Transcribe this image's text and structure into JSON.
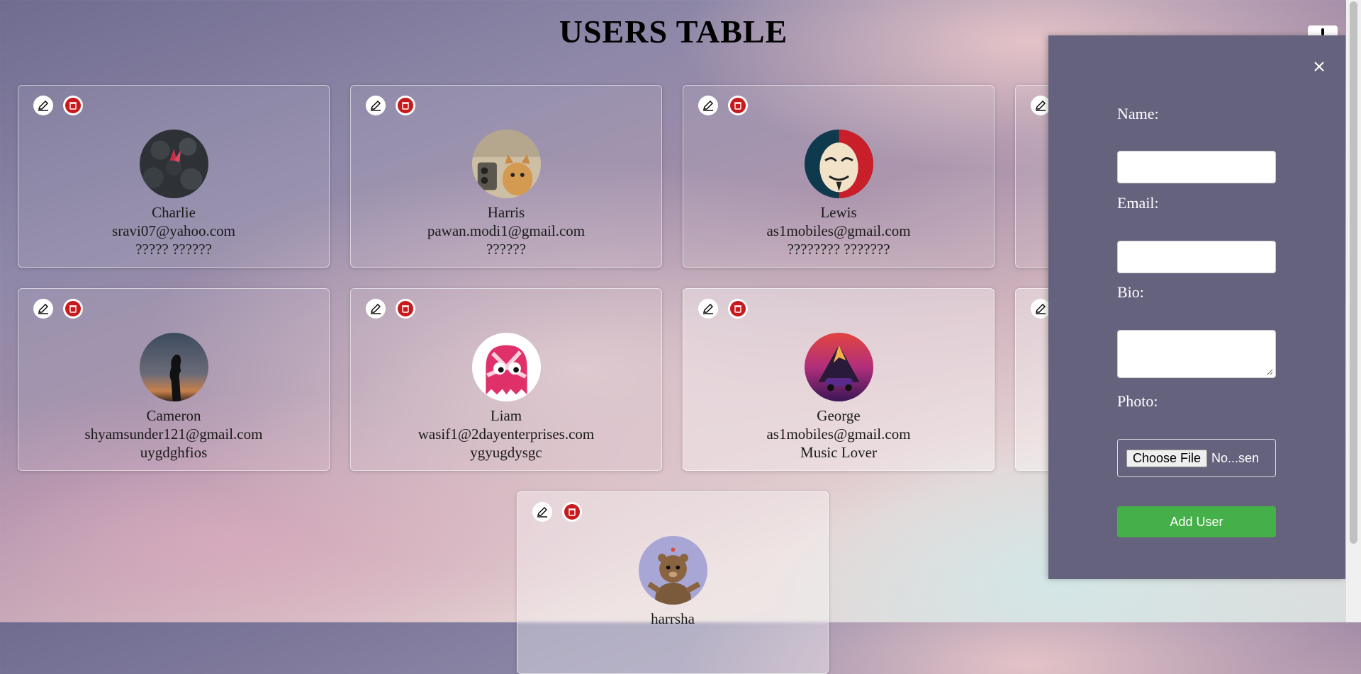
{
  "page": {
    "title": "USERS TABLE"
  },
  "users": [
    {
      "name": "Charlie",
      "email": "sravi07@yahoo.com",
      "bio": "????? ??????"
    },
    {
      "name": "Harris",
      "email": "pawan.modi1@gmail.com",
      "bio": "??????"
    },
    {
      "name": "Lewis",
      "email": "as1mobiles@gmail.com",
      "bio": "???????? ???????"
    },
    {
      "name": "Cameron",
      "email": "shyamsunder121@gmail.com",
      "bio": "uygdghfios"
    },
    {
      "name": "Liam",
      "email": "wasif1@2dayenterprises.com",
      "bio": "ygyugdysgc"
    },
    {
      "name": "George",
      "email": "as1mobiles@gmail.com",
      "bio": "Music Lover"
    },
    {
      "name": "harrsha",
      "email": "",
      "bio": ""
    }
  ],
  "form": {
    "name_label": "Name:",
    "email_label": "Email:",
    "bio_label": "Bio:",
    "photo_label": "Photo:",
    "choose_file_label": "Choose File",
    "file_status": "No...sen",
    "submit_label": "Add User"
  },
  "icons": {
    "edit": "pencil-icon",
    "delete": "trash-icon",
    "close": "close-icon"
  },
  "colors": {
    "panel": "#65627d",
    "submit": "#45b049",
    "delete": "#c8191d"
  }
}
